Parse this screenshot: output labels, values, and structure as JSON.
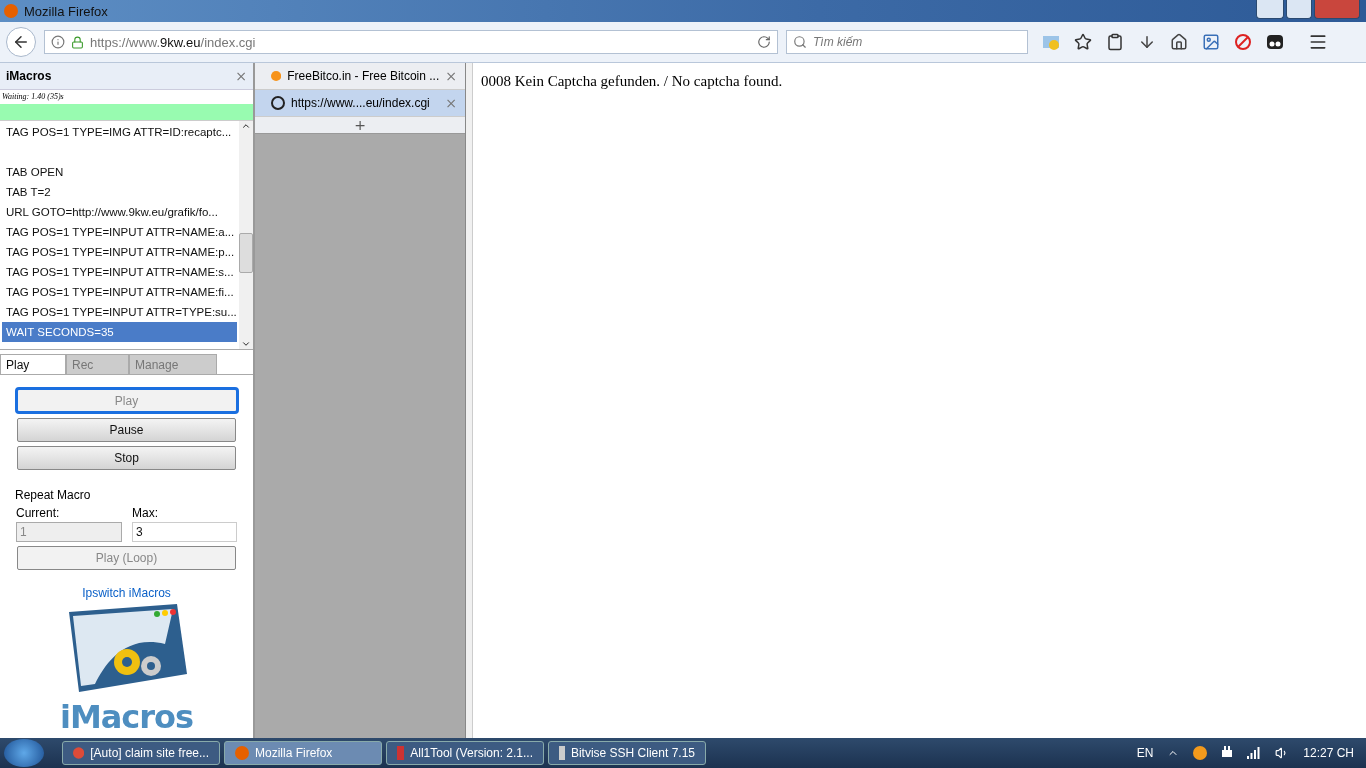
{
  "window": {
    "title": "Mozilla Firefox"
  },
  "navbar": {
    "url_prefix": "https://www.",
    "url_domain": "9kw.eu",
    "url_path": "/index.cgi",
    "search_placeholder": "Tìm kiếm"
  },
  "imacros": {
    "title": "iMacros",
    "close": "×",
    "status": "Waiting: 1.40 (35)s",
    "progress": {
      "level": 1
    },
    "lines": [
      {
        "kind": "code",
        "text": "TAG POS=1 TYPE=IMG ATTR=ID:recaptc...",
        "selected": false
      },
      {
        "kind": "blank"
      },
      {
        "kind": "code",
        "text": "TAB OPEN",
        "selected": false
      },
      {
        "kind": "code",
        "text": "TAB T=2",
        "selected": false
      },
      {
        "kind": "code",
        "text": "URL GOTO=http://www.9kw.eu/grafik/fo...",
        "selected": false
      },
      {
        "kind": "code",
        "text": "TAG POS=1 TYPE=INPUT ATTR=NAME:a...",
        "selected": false
      },
      {
        "kind": "code",
        "text": "TAG POS=1 TYPE=INPUT ATTR=NAME:p...",
        "selected": false
      },
      {
        "kind": "code",
        "text": "TAG POS=1 TYPE=INPUT ATTR=NAME:s...",
        "selected": false
      },
      {
        "kind": "code",
        "text": "TAG POS=1 TYPE=INPUT ATTR=NAME:fi...",
        "selected": false
      },
      {
        "kind": "code",
        "text": "TAG POS=1 TYPE=INPUT ATTR=TYPE:su...",
        "selected": false
      },
      {
        "kind": "code",
        "text": "WAIT SECONDS=35",
        "selected": true
      }
    ],
    "tabs": [
      {
        "label": "Play",
        "selected": true
      },
      {
        "label": "Rec",
        "selected": false
      },
      {
        "label": "Manage",
        "selected": false
      }
    ],
    "buttons": [
      {
        "label": "Play",
        "disabled": true,
        "focused": true
      },
      {
        "label": "Pause",
        "disabled": false,
        "focused": false
      },
      {
        "label": "Stop",
        "disabled": false,
        "focused": false
      }
    ],
    "repeat": {
      "title": "Repeat Macro",
      "current_label": "Current:",
      "current_value": "1",
      "max_label": "Max:",
      "max_value": "3",
      "loop_button": {
        "label": "Play (Loop)",
        "disabled": true
      }
    },
    "link": "Ipswitch iMacros",
    "logo_text": "iMacros"
  },
  "browser_tabs": [
    {
      "title": "FreeBitco.in - Free Bitcoin ...",
      "close": "×",
      "selected": false
    },
    {
      "title": "https://www....eu/index.cgi",
      "close": "×",
      "selected": true
    }
  ],
  "new_tab": "+",
  "page": {
    "message": "0008 Kein Captcha gefunden. / No captcha found."
  },
  "taskbar": {
    "items": [
      {
        "label": "[Auto] claim site free...",
        "selected": false
      },
      {
        "label": "Mozilla Firefox",
        "selected": true
      },
      {
        "label": "All1Tool (Version: 2.1...",
        "selected": false
      },
      {
        "label": "Bitvise SSH Client 7.15",
        "selected": false
      }
    ],
    "language": "EN",
    "clock": "12:27 CH"
  }
}
